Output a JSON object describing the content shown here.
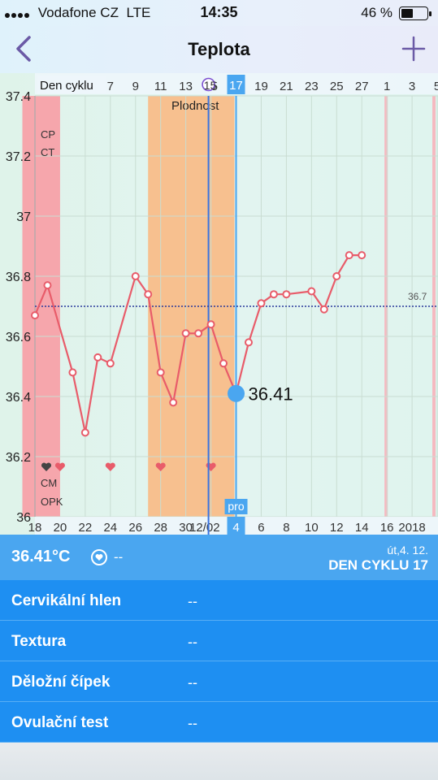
{
  "status_bar": {
    "carrier": "Vodafone CZ",
    "network": "LTE",
    "time": "14:35",
    "battery": "46 %",
    "battery_level": 0.46
  },
  "nav": {
    "title": "Teplota"
  },
  "chart_data": {
    "type": "line",
    "title": "",
    "xlabel": "",
    "ylabel": "",
    "top_axis_label": "Den cyklu",
    "top_ticks": [
      {
        "day": 5,
        "label": "5"
      },
      {
        "day": 7,
        "label": "7"
      },
      {
        "day": 9,
        "label": "9"
      },
      {
        "day": 11,
        "label": "11"
      },
      {
        "day": 13,
        "label": "13"
      },
      {
        "day": 15,
        "label": "15"
      },
      {
        "day": 17,
        "label": "17"
      },
      {
        "day": 19,
        "label": "19"
      },
      {
        "day": 21,
        "label": "21"
      },
      {
        "day": 23,
        "label": "23"
      },
      {
        "day": 25,
        "label": "25"
      },
      {
        "day": 27,
        "label": "27"
      },
      {
        "day": 29,
        "label": "1"
      },
      {
        "day": 31,
        "label": "3"
      },
      {
        "day": 33,
        "label": "5"
      }
    ],
    "bottom_ticks": [
      {
        "day": 1,
        "label": "18"
      },
      {
        "day": 3,
        "label": "20"
      },
      {
        "day": 5,
        "label": "22"
      },
      {
        "day": 7,
        "label": "24"
      },
      {
        "day": 9,
        "label": "26"
      },
      {
        "day": 11,
        "label": "28"
      },
      {
        "day": 13,
        "label": "30"
      },
      {
        "day": 14.5,
        "label": "12/02"
      },
      {
        "day": 17,
        "label": "4"
      },
      {
        "day": 19,
        "label": "6"
      },
      {
        "day": 21,
        "label": "8"
      },
      {
        "day": 23,
        "label": "10"
      },
      {
        "day": 25,
        "label": "12"
      },
      {
        "day": 27,
        "label": "14"
      },
      {
        "day": 29,
        "label": "16"
      },
      {
        "day": 31,
        "label": "2018"
      }
    ],
    "ylim": [
      36.0,
      37.4
    ],
    "y_ticks": [
      "37.4",
      "37.2",
      "37",
      "36.8",
      "36.6",
      "36.4",
      "36.2",
      "36"
    ],
    "x": [
      1,
      2,
      4,
      5,
      6,
      7,
      9,
      10,
      11,
      12,
      13,
      14,
      15,
      16,
      17,
      18,
      19,
      20,
      21,
      23,
      24,
      25,
      26,
      27
    ],
    "series": [
      {
        "values": [
          36.67,
          36.77,
          36.48,
          36.28,
          36.53,
          36.51,
          36.8,
          36.74,
          36.48,
          36.38,
          36.61,
          36.61,
          36.64,
          36.51,
          36.41,
          36.58,
          36.71,
          36.74,
          36.74,
          36.75,
          36.69,
          36.8,
          36.87,
          36.87
        ]
      }
    ],
    "coverline_value": 36.7,
    "coverline_label": "36.7",
    "selected": {
      "day": 17,
      "value": "36.41",
      "top_label": "17",
      "bottom_label": "4",
      "tag": "pro"
    },
    "period_days": [
      1,
      3
    ],
    "fertile_label": "Plodnost",
    "fertile_days": [
      10,
      16
    ],
    "heart_days": [
      1,
      3,
      7,
      11,
      15
    ],
    "ovulation_day": 15,
    "row_labels": {
      "cp": "CP",
      "ct": "CT",
      "cm": "CM",
      "opk": "OPK"
    },
    "colors": {
      "period": "#f6a6ac",
      "fertile": "#f7c08f",
      "line": "#e85c6a",
      "accent": "#4aa6f0",
      "coverline": "#2b3a9c",
      "ovulation": "#7b4fd0"
    }
  },
  "panel": {
    "temperature": "36.41°C",
    "dash": "--",
    "date": "út,4. 12.",
    "cycle_day": "DEN CYKLU 17"
  },
  "details": [
    {
      "label": "Cervikální hlen",
      "value": "--"
    },
    {
      "label": "Textura",
      "value": "--"
    },
    {
      "label": "Děložní čípek",
      "value": "--"
    },
    {
      "label": "Ovulační test",
      "value": "--"
    }
  ]
}
